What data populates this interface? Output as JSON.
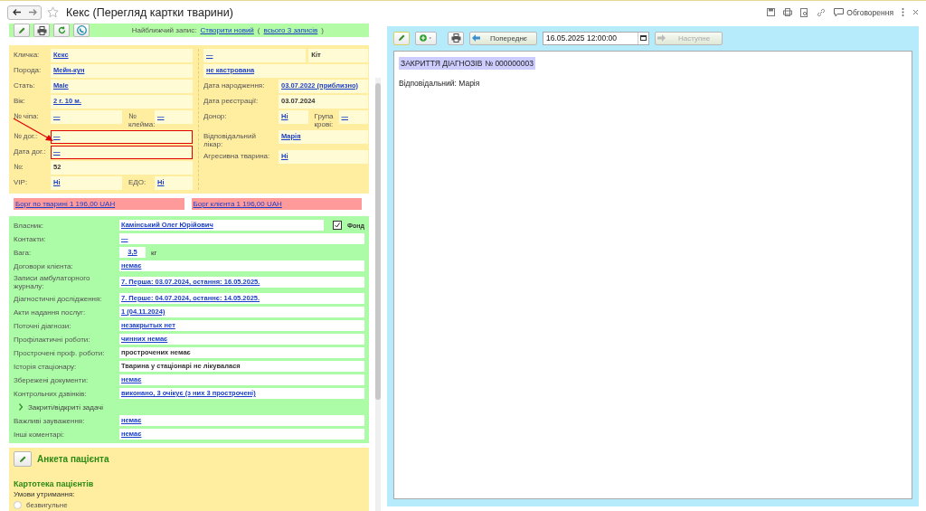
{
  "window": {
    "title": "Кекс (Перегляд картки тварини)",
    "discussion": "Обговорення"
  },
  "left_toolbar": {
    "nearest_label": "Найближчий запис:",
    "create_link": "Створити новий",
    "open_paren": "(",
    "all_link": "всього 3 записів",
    "close_paren": ")"
  },
  "info_left": [
    {
      "fields": [
        {
          "label": "Кличка:",
          "value": "Кекс",
          "link": true,
          "highlighted": false
        }
      ]
    },
    {
      "fields": [
        {
          "label": "Порода:",
          "value": "Мейн-кун",
          "link": true,
          "highlighted": false
        }
      ]
    },
    {
      "fields": [
        {
          "label": "Стать:",
          "value": "Male",
          "link": true,
          "highlighted": false
        }
      ]
    },
    {
      "fields": [
        {
          "label": "Вік:",
          "value": "2 г. 10 м.",
          "link": true,
          "highlighted": false
        }
      ]
    },
    {
      "fields": [
        {
          "label": "№ чіпа:",
          "value": "—",
          "link": true,
          "highlighted": false
        },
        {
          "label": "№ клейма:",
          "value": "—",
          "link": true,
          "highlighted": false
        }
      ]
    },
    {
      "fields": [
        {
          "label": "№ дог.:",
          "value": "—",
          "link": true,
          "highlighted": true
        }
      ]
    },
    {
      "fields": [
        {
          "label": "Дата дог.:",
          "value": "—",
          "link": true,
          "highlighted": true
        }
      ]
    },
    {
      "fields": [
        {
          "label": "№:",
          "value": "52",
          "link": false,
          "highlighted": false
        }
      ]
    },
    {
      "fields": [
        {
          "label": "VIP:",
          "value": "Ні",
          "link": true,
          "highlighted": false
        },
        {
          "label": "ЕДО:",
          "value": "Ні",
          "link": true,
          "highlighted": false
        }
      ]
    }
  ],
  "info_right": [
    {
      "fields": [
        {
          "value": "—",
          "link": true
        },
        {
          "value": "Кіт",
          "link": false
        }
      ]
    },
    {
      "fields": [
        {
          "value": "не кастрована",
          "link": true
        }
      ]
    },
    {
      "fields": [
        {
          "label": "Дата народження:",
          "value": "03.07.2022 (приблизно)",
          "link": true
        }
      ]
    },
    {
      "fields": [
        {
          "label": "Дата реєстрації:",
          "value": "03.07.2024",
          "link": false
        }
      ]
    },
    {
      "fields": [
        {
          "label": "Донор:",
          "value": "Ні",
          "link": true
        },
        {
          "label": "Група крові:",
          "value": "—",
          "link": true
        }
      ]
    },
    {
      "fields": [
        {
          "label": "Відповідальний лікар:",
          "value": "Марія",
          "link": true
        }
      ]
    },
    {
      "fields": [
        {
          "label": "Агресивна тварина:",
          "value": "Ні",
          "link": true
        }
      ]
    }
  ],
  "debts": [
    "Борг по тварині 1 196,00 UAH",
    "Борг клієнта 1 196,00 UAH"
  ],
  "owner_rows": [
    {
      "kind": "field",
      "label": "Власник:",
      "value": "Камінський Олег Юрійович",
      "link": true,
      "checkbox": {
        "label": "Фонд",
        "checked": true
      }
    },
    {
      "kind": "field",
      "label": "Контакти:",
      "value": "—",
      "link": true
    },
    {
      "kind": "weight",
      "label": "Вага:",
      "value": "3,5",
      "unit": "кг"
    },
    {
      "kind": "field",
      "label": "Договори клієнта:",
      "value": "немає",
      "link": true
    },
    {
      "kind": "field",
      "label": "Записи амбулаторного журналу:",
      "value": "7. Перша: 03.07.2024, остання: 16.05.2025.",
      "link": true
    },
    {
      "kind": "field",
      "label": "Діагностичні дослідження:",
      "value": "7. Перше: 04.07.2024, останнє: 14.05.2025.",
      "link": true
    },
    {
      "kind": "field",
      "label": "Акти надання послуг:",
      "value": "1 (04.11.2024)",
      "link": true
    },
    {
      "kind": "field",
      "label": "Поточні діагнози:",
      "value": "незакрытых нет",
      "link": true
    },
    {
      "kind": "field",
      "label": "Профілактичні роботи:",
      "value": "чинних немає",
      "link": true
    },
    {
      "kind": "field",
      "label": "Прострочені проф. роботи:",
      "value": "прострочених немає",
      "link": false
    },
    {
      "kind": "field",
      "label": "Історія стаціонару:",
      "value": "Тварина у стаціонарі не лікувалася",
      "link": false
    },
    {
      "kind": "field",
      "label": "Збережені документи:",
      "value": "немає",
      "link": true
    },
    {
      "kind": "field",
      "label": "Контрольних дзвінків:",
      "value": " виконано, 3 очікує (з них 3 прострочені)",
      "link": true
    },
    {
      "kind": "expander",
      "label": "Закриті/відкриті задачі",
      "expanded": false
    },
    {
      "kind": "field",
      "label": "Важливі зауваження:",
      "value": "немає",
      "link": true
    },
    {
      "kind": "field",
      "label": "Інші коментарі:",
      "value": "немає",
      "link": true
    }
  ],
  "questionnaire": {
    "title": "Анкета пацієнта",
    "section": "Картотека пацієнтів",
    "question": "Умови утримання:",
    "options": [
      {
        "label": "безвигульне",
        "selected": false
      }
    ]
  },
  "right_panel": {
    "previous": "Попереднє",
    "date": "16.05.2025 12:00:00",
    "next": "Наступне",
    "next_disabled": true,
    "doc_title": "ЗАКРИТТЯ ДІАГНОЗІВ № 000000003",
    "responsible": "Відповідальний: Марія"
  }
}
